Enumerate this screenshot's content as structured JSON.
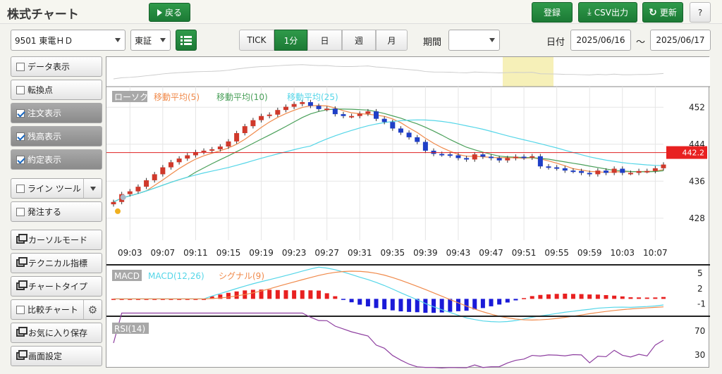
{
  "header": {
    "title": "株式チャート",
    "back_label": "戻る",
    "register_label": "登録",
    "csv_label": "CSV出力",
    "refresh_label": "更新",
    "help_label": "?"
  },
  "toolbar": {
    "symbol": "9501 東電ＨＤ",
    "market": "東証",
    "intervals": [
      "TICK",
      "1分",
      "日",
      "週",
      "月"
    ],
    "active_interval": "1分",
    "period_label": "期間",
    "period_value": "",
    "date_label": "日付",
    "date_from": "2025/06/16",
    "date_sep": "～",
    "date_to": "2025/06/17"
  },
  "sidebar": {
    "items": [
      {
        "label": "データ表示",
        "type": "check",
        "checked": false
      },
      {
        "label": "転換点",
        "type": "check",
        "checked": false
      },
      {
        "label": "注文表示",
        "type": "check",
        "checked": true
      },
      {
        "label": "残高表示",
        "type": "check",
        "checked": true
      },
      {
        "label": "約定表示",
        "type": "check",
        "checked": true
      },
      {
        "label": "ライン ツール",
        "type": "check-dropdown",
        "checked": false
      },
      {
        "label": "発注する",
        "type": "check",
        "checked": false
      },
      {
        "label": "カーソルモード",
        "type": "window"
      },
      {
        "label": "テクニカル指標",
        "type": "window"
      },
      {
        "label": "チャートタイプ",
        "type": "window"
      },
      {
        "label": "比較チャート",
        "type": "check-gear",
        "checked": false
      },
      {
        "label": "お気に入り保存",
        "type": "window"
      },
      {
        "label": "画面設定",
        "type": "window"
      }
    ]
  },
  "chart": {
    "legend": [
      "ローソク",
      "移動平均(5)",
      "移動平均(10)",
      "移動平均(25)"
    ],
    "current_price": "442.2",
    "y_ticks": [
      "452",
      "444",
      "436",
      "428"
    ],
    "x_ticks": [
      "09:03",
      "09:07",
      "09:11",
      "09:15",
      "09:19",
      "09:23",
      "09:27",
      "09:31",
      "09:35",
      "09:39",
      "09:43",
      "09:47",
      "09:51",
      "09:55",
      "09:59",
      "10:03",
      "10:07"
    ],
    "macd_legend": [
      "MACD",
      "MACD(12,26)",
      "シグナル(9)"
    ],
    "macd_ticks": [
      "5",
      "2",
      "-1"
    ],
    "rsi_legend": [
      "RSI(14)"
    ],
    "rsi_ticks": [
      "70",
      "30"
    ],
    "colors": {
      "up": "#d0392b",
      "down": "#1f3fc7",
      "ma5": "#f08a4b",
      "ma10": "#4aa05a",
      "ma25": "#55d6e8",
      "rsi": "#8e3fa0",
      "price_line": "#e02020"
    }
  },
  "chart_data": {
    "type": "candlestick",
    "x": [
      "09:01",
      "09:02",
      "09:03",
      "09:04",
      "09:05",
      "09:06",
      "09:07",
      "09:08",
      "09:09",
      "09:10",
      "09:11",
      "09:12",
      "09:13",
      "09:14",
      "09:15",
      "09:16",
      "09:17",
      "09:18",
      "09:19",
      "09:20",
      "09:21",
      "09:22",
      "09:23",
      "09:24",
      "09:25",
      "09:26",
      "09:27",
      "09:28",
      "09:29",
      "09:30",
      "09:31",
      "09:32",
      "09:33",
      "09:34",
      "09:35",
      "09:36",
      "09:37",
      "09:38",
      "09:39",
      "09:40",
      "09:41",
      "09:42",
      "09:43",
      "09:44",
      "09:45",
      "09:46",
      "09:47",
      "09:48",
      "09:49",
      "09:50",
      "09:51",
      "09:52",
      "09:53",
      "09:54",
      "09:55",
      "09:56",
      "09:57",
      "09:58",
      "09:59",
      "10:00",
      "10:01",
      "10:02",
      "10:03",
      "10:04",
      "10:05",
      "10:06",
      "10:07",
      "10:08"
    ],
    "close": [
      431.5,
      433.2,
      433.8,
      434.8,
      436.2,
      437.5,
      439.0,
      440.1,
      440.9,
      441.6,
      442.3,
      442.6,
      442.9,
      443.5,
      444.6,
      446.4,
      447.9,
      449.2,
      450.1,
      450.4,
      451.4,
      452.1,
      452.7,
      453.1,
      452.3,
      451.6,
      451.7,
      450.5,
      450.1,
      450.1,
      450.6,
      451.1,
      449.5,
      448.8,
      447.4,
      446.5,
      445.5,
      444.5,
      442.6,
      441.9,
      441.8,
      441.6,
      441.0,
      440.7,
      441.8,
      441.3,
      441.0,
      440.5,
      441.0,
      441.3,
      441.1,
      441.4,
      439.2,
      439.0,
      438.8,
      438.3,
      438.2,
      437.8,
      437.5,
      438.3,
      437.8,
      438.7,
      437.8,
      437.8,
      438.2,
      438.2,
      438.8,
      439.6
    ],
    "y_range": [
      424,
      456
    ],
    "ma_series": [
      "移動平均(5)",
      "移動平均(10)",
      "移動平均(25)"
    ],
    "macd_range": [
      -3,
      6
    ],
    "rsi_range": [
      10,
      90
    ]
  }
}
